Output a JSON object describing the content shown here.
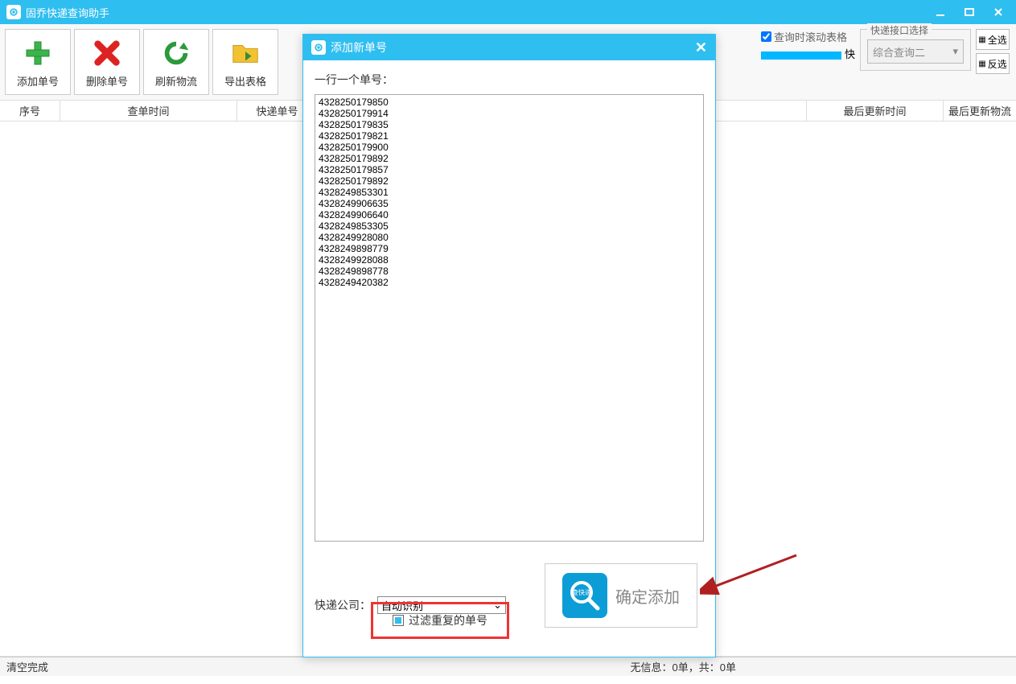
{
  "app": {
    "title": "固乔快递查询助手"
  },
  "toolbar": {
    "add_label": "添加单号",
    "delete_label": "删除单号",
    "refresh_label": "刷新物流",
    "export_label": "导出表格",
    "scroll_on_query_label": "查询时滚动表格",
    "speed_unit": "快",
    "interface_group_label": "快递接口选择",
    "interface_selected": "综合查询二",
    "select_all_label": "全选",
    "invert_label": "反选"
  },
  "table": {
    "headers": {
      "seq": "序号",
      "query_time": "查单时间",
      "tracking_no": "快递单号",
      "last_update_time": "最后更新时间",
      "last_update_log": "最后更新物流"
    }
  },
  "status": {
    "left": "清空完成",
    "mid": "无信息：0单，共：0单"
  },
  "dialog": {
    "title": "添加新单号",
    "prompt": "一行一个单号：",
    "textarea_value": "4328250179850\n4328250179914\n4328250179835\n4328250179821\n4328250179900\n4328250179892\n4328250179857\n4328250179892\n4328249853301\n4328249906635\n4328249906640\n4328249853305\n4328249928080\n4328249898779\n4328249928088\n4328249898778\n4328249420382",
    "company_label": "快递公司：",
    "company_selected": "自动识别",
    "filter_label": "过滤重复的单号",
    "confirm_label": "确定添加",
    "confirm_icon_text": "查快递"
  }
}
